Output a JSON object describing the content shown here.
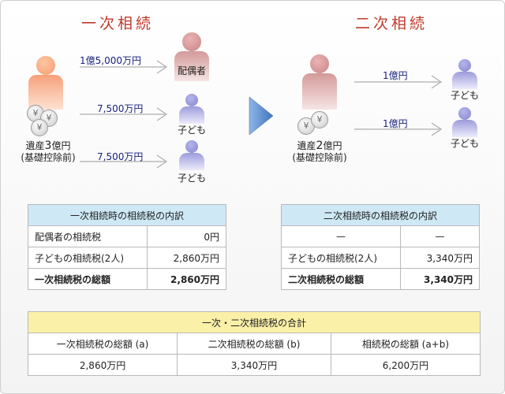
{
  "first": {
    "title": "一次相続",
    "estate_prefix": "遺産",
    "estate_num": "3",
    "estate_suffix": "億円",
    "estate_note": "(基礎控除前)",
    "spouse_label": "配偶者",
    "amount_spouse": "1億5,000万円",
    "amount_child1": "7,500万円",
    "amount_child2": "7,500万円",
    "child1_label": "子ども",
    "child2_label": "子ども"
  },
  "second": {
    "title": "二次相続",
    "estate_prefix": "遺産",
    "estate_num": "2",
    "estate_suffix": "億円",
    "estate_note": "(基礎控除前)",
    "amount_child1": "1億円",
    "amount_child2": "1億円",
    "child1_label": "子ども",
    "child2_label": "子ども"
  },
  "coin_glyph": "¥",
  "table_first": {
    "header": "一次相続時の相続税の内訳",
    "rows": [
      {
        "label": "配偶者の相続税",
        "value": "0円"
      },
      {
        "label": "子どもの相続税(2人)",
        "value": "2,860万円"
      },
      {
        "label": "一次相続税の総額",
        "value": "2,860万円"
      }
    ]
  },
  "table_second": {
    "header": "二次相続時の相続税の内訳",
    "rows": [
      {
        "label": "—",
        "value": "—"
      },
      {
        "label": "子どもの相続税(2人)",
        "value": "3,340万円"
      },
      {
        "label": "二次相続税の総額",
        "value": "3,340万円"
      }
    ]
  },
  "table_total": {
    "header": "一次・二次相続税の合計",
    "columns": [
      "一次相続税の総額 (a)",
      "二次相続税の総額 (b)",
      "相続税の総額 (a+b)"
    ],
    "values": [
      "2,860万円",
      "3,340万円",
      "6,200万円"
    ]
  },
  "colors": {
    "title": "#c0392b",
    "amount": "#1a237e",
    "arrow": "#5b8fd0",
    "header_blue": "#cfe8f6",
    "header_yellow": "#fbf0a8"
  },
  "icons": [
    "person-icon",
    "yen-coin-icon",
    "right-arrow-icon"
  ]
}
